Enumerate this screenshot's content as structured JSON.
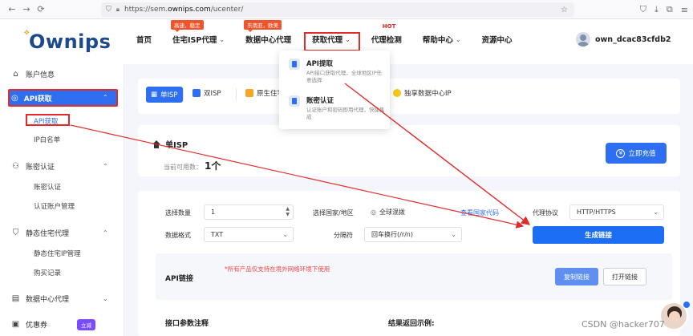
{
  "browser": {
    "url_prefix": "https://sem.",
    "url_domain": "ownips.com",
    "url_path": "/ucenter/"
  },
  "header": {
    "logo": "Ownips",
    "nav": [
      {
        "label": "首页"
      },
      {
        "label": "住宅ISP代理",
        "tag": "高速，稳定"
      },
      {
        "label": "数据中心代理",
        "tag": "东南亚，欧美"
      },
      {
        "label": "获取代理"
      },
      {
        "label": "代理检测",
        "tag": "HOT"
      },
      {
        "label": "帮助中心"
      },
      {
        "label": "资源中心"
      }
    ],
    "username": "own_dcac83cfdb2"
  },
  "dropdown": {
    "items": [
      {
        "title": "API提取",
        "desc": "API接口获取代理，全球地区IP任意选择"
      },
      {
        "title": "账密认证",
        "desc": "认证账户和密码即用代理，快捷集成"
      }
    ]
  },
  "sidebar": {
    "account_info": "账户信息",
    "api_group": "API获取",
    "api_sub": [
      "API获取",
      "IP白名单"
    ],
    "auth_group": "账密认证",
    "auth_sub": [
      "账密认证",
      "认证账户管理"
    ],
    "static_group": "静态住宅代理",
    "static_sub": [
      "静态住宅IP管理",
      "购买记录"
    ],
    "datacenter_group": "数据中心代理",
    "coupon": "优惠券",
    "coupon_badge": "立减"
  },
  "tabs": [
    "单ISP",
    "双ISP",
    "原生住宅",
    "独享数据中心IP"
  ],
  "isp": {
    "title": "单ISP",
    "available_label": "当前可用数：",
    "available_value": "1个",
    "recharge": "立即充值"
  },
  "form": {
    "qty_label": "选择数量",
    "qty_value": "1",
    "country_label": "选择国家/地区",
    "country_value": "全球混拨",
    "country_link": "查看国家代码",
    "protocol_label": "代理协议",
    "protocol_value": "HTTP/HTTPS",
    "format_label": "数据格式",
    "format_value": "TXT",
    "sep_label": "分隔符",
    "sep_value": "回车换行(/r/n)",
    "generate": "生成链接",
    "api_link_label": "API链接",
    "api_note": "*所有产品仅支持在境外网络环境下使用",
    "copy": "复制链接",
    "open": "打开链接",
    "param_title": "接口参数注释",
    "return_title": "结果返回示例:"
  },
  "watermark": "CSDN @hacker707"
}
